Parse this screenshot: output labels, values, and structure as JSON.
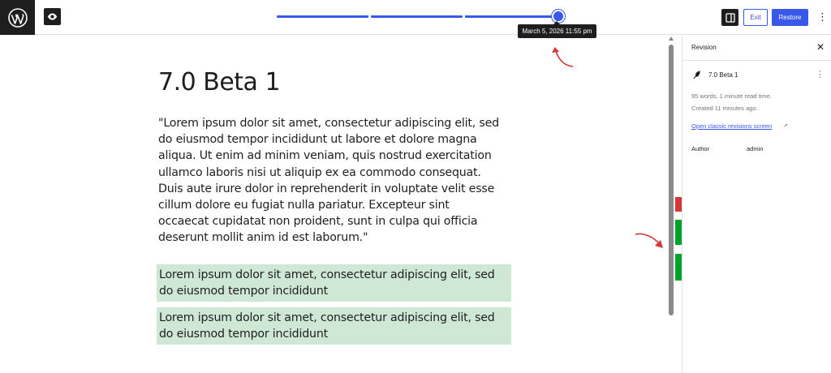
{
  "topbar": {
    "logo_icon": "wordpress-icon",
    "preview_icon": "eye-icon",
    "timeline_tooltip": "March 5, 2026 11:55 pm",
    "timeline_accent": "#3858e9",
    "sidebar_toggle_icon": "sidebar-icon",
    "exit_label": "Exit",
    "restore_label": "Restore",
    "more_icon": "more-vertical-icon",
    "more_label": "⋮"
  },
  "post": {
    "title": "7.0 Beta 1",
    "paragraph": "\"Lorem ipsum dolor sit amet, consectetur adipiscing elit, sed do eiusmod tempor incididunt ut labore et dolore magna aliqua. Ut enim ad minim veniam, quis nostrud exercitation ullamco laboris nisi ut aliquip ex ea commodo consequat. Duis aute irure dolor in reprehenderit in voluptate velit esse cillum dolore eu fugiat nulla pariatur. Excepteur sint occaecat cupidatat non proident, sunt in culpa qui officia deserunt mollit anim id est laborum.\"",
    "added_blocks": [
      "Lorem ipsum dolor sit amet, consectetur adipiscing elit, sed do eiusmod tempor incididunt",
      "Lorem ipsum dolor sit amet, consectetur adipiscing elit, sed do eiusmod tempor incididunt"
    ],
    "added_color": "#cfe8d6"
  },
  "diff_markers": {
    "removed_color": "#d63638",
    "added_color": "#00a32a"
  },
  "panel": {
    "tab_label": "Revision",
    "close_label": "✕",
    "revision_icon": "feather-icon",
    "revision_title": "7.0 Beta 1",
    "revision_more": "⋮",
    "meta_words": "95 words, 1 minute read time.",
    "meta_created": "Created 11 minutes ago.",
    "classic_link": "Open classic revisions screen",
    "external_icon": "↗",
    "author_label": "Author",
    "author_value": "admin"
  }
}
